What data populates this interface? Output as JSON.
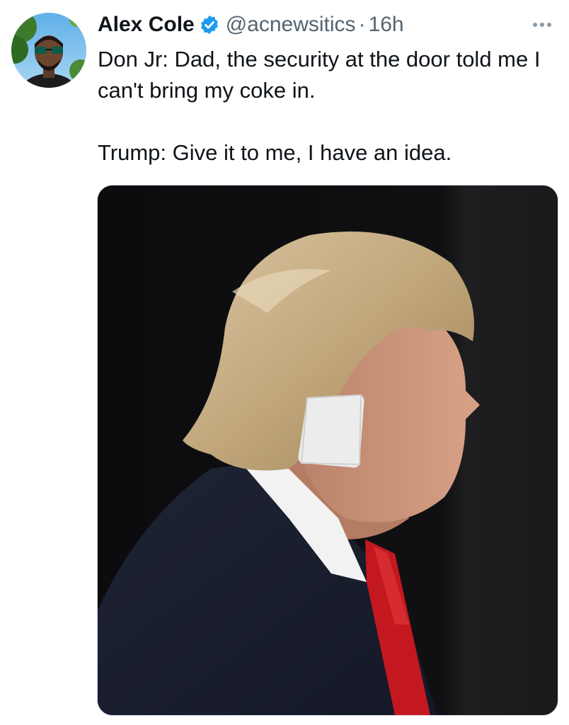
{
  "tweet": {
    "author": {
      "display_name": "Alex Cole",
      "handle": "@acnewsitics",
      "verified": true,
      "avatar_icon": "user-avatar"
    },
    "separator": "·",
    "timestamp": "16h",
    "more_icon": "more-icon",
    "text_lines": [
      "Don Jr: Dad, the security at the door told me I can't bring my coke in.",
      "Trump: Give it to me, I have an idea."
    ],
    "media": {
      "type": "photo"
    }
  },
  "colors": {
    "text_primary": "#0f1419",
    "text_secondary": "#536471",
    "verified_blue": "#1d9bf0",
    "media_border": "#d6dde3"
  }
}
